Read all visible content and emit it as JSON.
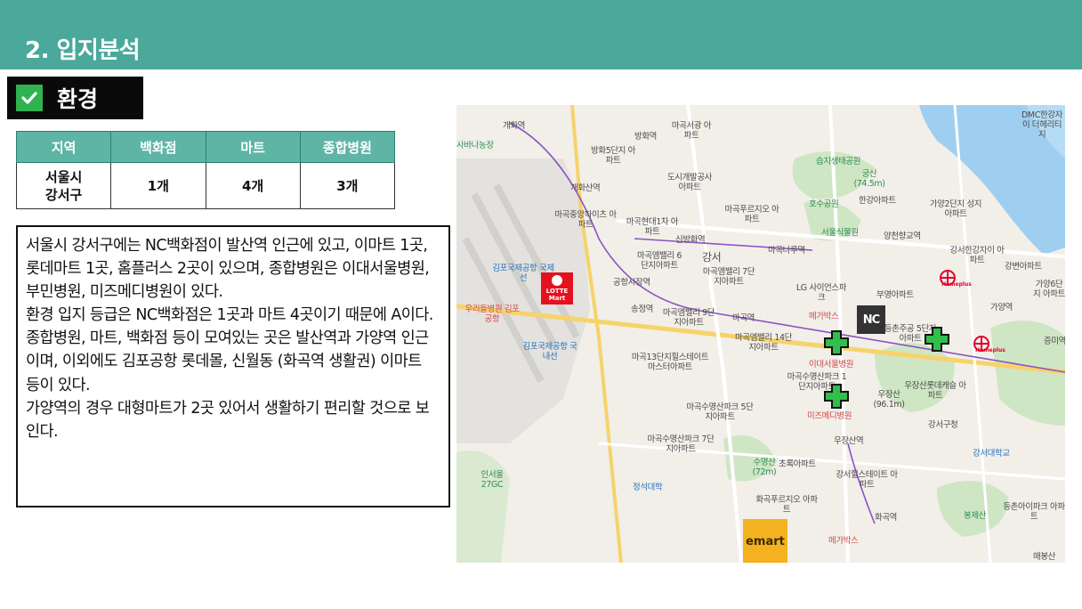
{
  "header": {
    "title": "2. 입지분석"
  },
  "section": {
    "label": "환경",
    "check_icon": "check-icon",
    "check_color": "#2fb24f"
  },
  "colors": {
    "header_bg": "#4aa99a",
    "table_header_bg": "#5fb5a5"
  },
  "table": {
    "columns": [
      "지역",
      "백화점",
      "마트",
      "종합병원"
    ],
    "row": {
      "region_line1": "서울시",
      "region_line2": "강서구",
      "dept": "1개",
      "mart": "4개",
      "hospital": "3개"
    }
  },
  "description": {
    "p1": "서울시 강서구에는 NC백화점이 발산역 인근에 있고, 이마트 1곳, 롯데마트 1곳, 홈플러스 2곳이 있으며, 종합병원은 이대서울병원, 부민병원, 미즈메디병원이 있다.",
    "p2": "환경 입지 등급은 NC백화점은 1곳과 마트 4곳이기 때문에 A이다.",
    "p3": "종합병원, 마트, 백화점 등이 모여있는 곳은 발산역과 가양역 인근이며, 이외에도 김포공항 롯데몰, 신월동 (화곡역 생활권) 이마트 등이 있다.",
    "p4": "가양역의 경우 대형마트가 2곳 있어서 생활하기 편리할 것으로 보인다."
  },
  "map": {
    "labels": {
      "gaehwa": "개화역",
      "sabana": "사바나농장",
      "banghwa": "방화역",
      "magokseogwang": "마곡서광 아파트",
      "banghwa5": "방화5단지 아파트",
      "gaehwasan": "개화산역",
      "dosi": "도시개발공사 아파트",
      "seupji": "습지생태공원",
      "gungsan": "궁산 (74.5m)",
      "hanggang": "한강아파트",
      "gayang2": "가양2단지 성지아파트",
      "magokjungang": "마곡중앙하이츠 아파트",
      "magokhyundai": "마곡현대1차 아파트",
      "magokpureuji": "마곡푸르지오 아파트",
      "hojusu": "호수공원",
      "seoulsik": "서울식물원",
      "yangcheon": "양천향교역",
      "sinbanghwa": "신방화역",
      "magoknaru": "마곡나루역",
      "magokemv6": "마곡엠밸리 6단지아파트",
      "gangseo": "강서",
      "magokemv7": "마곡엠밸리 7단지아파트",
      "gangseohangang": "강서한강자이 아파트",
      "gangbyeon": "강변아파트",
      "gimpoairport": "김포국제공항 국제선",
      "gonghangsijang": "공항시장역",
      "lg": "LG 사이언스파크",
      "buyoung": "부영아파트",
      "gayang6": "가양6단지 아파트",
      "urideul": "우리들병원 김포공항",
      "songjeong": "송정역",
      "magokemv9": "마곡엠밸리 9단지아파트",
      "magokstation": "마곡역",
      "megabox1": "메가박스",
      "gayangstation": "가양역",
      "deungchon": "등촌주공 5단지아파트",
      "jeungmi": "증미역",
      "domestic": "김포국제공항 국내선",
      "magokemv14": "마곡엠밸리 14단지아파트",
      "magok13": "마곡13단지힐스테이트 마스터아파트",
      "ewha": "이대서울병원",
      "magoksuyeong1": "마곡수명산파크 1단지아파트",
      "ujangsan": "우장산 (96.1m)",
      "ujangsanlotte": "우장산롯데캐슬 아파트",
      "magoksuyeong5": "마곡수명산파크 5단지아파트",
      "mizmedi": "미즈메디병원",
      "gangseogu": "강서구청",
      "ujangsan_st": "우장산역",
      "magoksuyeong7": "마곡수명산파크 7단지아파트",
      "gangseouniv": "강서대학교",
      "inseoul": "인서울 27GC",
      "jeongsuk": "정석대학",
      "suyeongsan": "수명산 (72m)",
      "chorok": "초록아파트",
      "gangseohills": "강서힐스테이트 아파트",
      "hwagokpureuji": "화곡푸르지오 아파트",
      "hwagok": "화곡역",
      "megabox2": "메가박스",
      "bongjesan": "봉제산",
      "deungchonipark": "등촌아이파크 아파트",
      "dmc": "DMC한강자이 더헤리티지",
      "mebongsan": "매봉산"
    },
    "brands": {
      "lotte_line1": "LOTTE",
      "lotte_line2": "Mart",
      "nc": "NC",
      "emart": "emart",
      "homeplus": "Homeplus"
    }
  }
}
